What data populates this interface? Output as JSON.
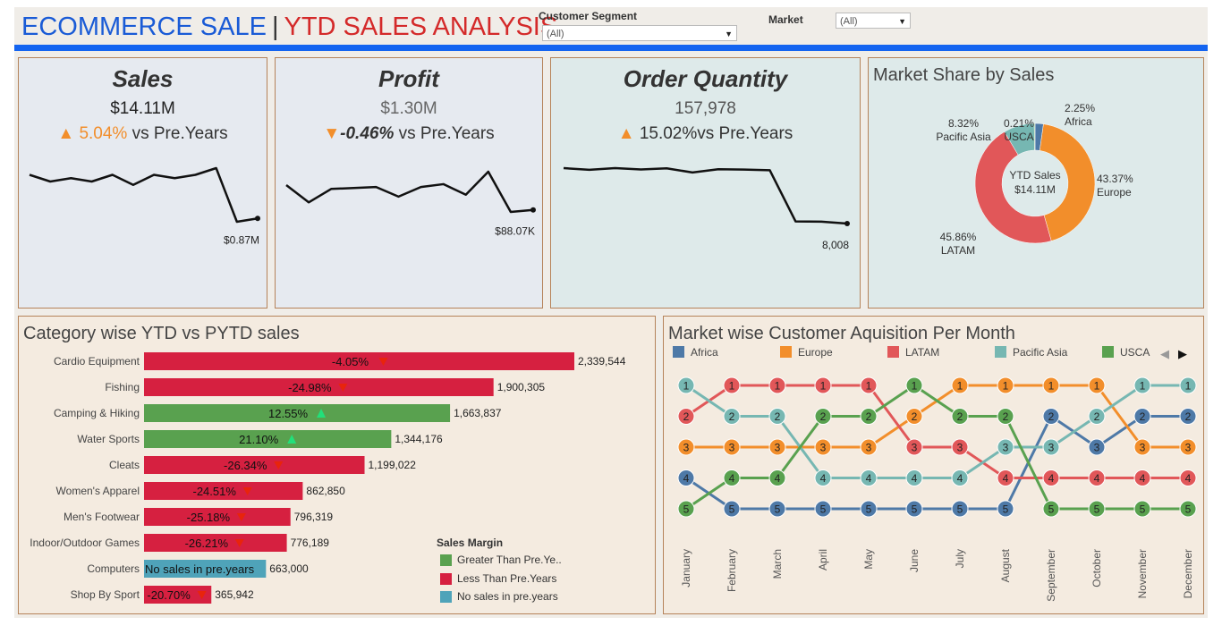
{
  "header": {
    "title_main": "ECOMMERCE SALE",
    "separator": "|",
    "title_sub": "YTD SALES ANALYSIS"
  },
  "filters": {
    "segment_label": "Customer Segment",
    "segment_value": "(All)",
    "market_label": "Market",
    "market_value": "(All)"
  },
  "kpis": {
    "sales": {
      "title": "Sales",
      "value": "$14.11M",
      "change": "5.04%",
      "suffix": " vs Pre.Years",
      "direction": "up",
      "last_label": "$0.87M"
    },
    "profit": {
      "title": "Profit",
      "value": "$1.30M",
      "change": "-0.46%",
      "suffix": " vs Pre.Years",
      "direction": "down",
      "last_label": "$88.07K"
    },
    "orders": {
      "title": "Order Quantity",
      "value": "157,978",
      "change": "15.02%",
      "suffix": "vs Pre.Years",
      "direction": "up",
      "last_label": "8,008"
    }
  },
  "colors": {
    "up": "#f28e2b",
    "down": "#f28e2b",
    "greater": "#59a14f",
    "less": "#d62040",
    "no_sales": "#4fa3b9",
    "africa": "#4e79a7",
    "europe": "#f28e2b",
    "latam": "#e15759",
    "pacific_asia": "#76b7b2",
    "usca": "#59a14f"
  },
  "market_share": {
    "title": "Market Share by Sales",
    "center_line1": "YTD Sales",
    "center_line2": "$14.11M"
  },
  "category_title": "Category wise YTD vs PYTD sales",
  "legend": {
    "title": "Sales Margin",
    "items": [
      "Greater Than Pre.Ye..",
      "Less Than Pre.Years",
      "No sales in pre.years"
    ]
  },
  "rank_title": "Market wise Customer Aquisition Per Month",
  "chart_data": [
    {
      "type": "line",
      "name": "sales_trend",
      "values": [
        0.99,
        0.97,
        0.98,
        0.97,
        0.99,
        0.96,
        0.99,
        0.98,
        0.99,
        1.01,
        0.85,
        0.86
      ],
      "end_label": "$0.87M"
    },
    {
      "type": "line",
      "name": "profit_trend",
      "values": [
        101,
        92,
        99,
        99.5,
        100,
        95,
        100,
        101.5,
        96,
        108,
        87,
        88.07
      ],
      "end_label": "$88.07K"
    },
    {
      "type": "line",
      "name": "order_quantity_trend",
      "values": [
        13100,
        12950,
        13100,
        12980,
        13080,
        12700,
        13000,
        12970,
        12900,
        8200,
        8180,
        8008
      ],
      "end_label": "8,008"
    },
    {
      "type": "pie",
      "name": "market_share",
      "title": "Market Share by Sales",
      "slices": [
        {
          "label": "Africa",
          "pct": "2.25%",
          "value": 2.25,
          "color": "#4e79a7"
        },
        {
          "label": "Europe",
          "pct": "43.37%",
          "value": 43.37,
          "color": "#f28e2b"
        },
        {
          "label": "LATAM",
          "pct": "45.86%",
          "value": 45.86,
          "color": "#e15759"
        },
        {
          "label": "Pacific Asia",
          "pct": "8.32%",
          "value": 8.32,
          "color": "#76b7b2"
        },
        {
          "label": "USCA",
          "pct": "0.21%",
          "value": 0.21,
          "color": "#59a14f"
        }
      ]
    },
    {
      "type": "bar",
      "name": "category_sales",
      "title": "Category wise YTD vs PYTD sales",
      "categories": [
        "Cardio Equipment",
        "Fishing",
        "Camping & Hiking",
        "Water Sports",
        "Cleats",
        "Women's Apparel",
        "Men's Footwear",
        "Indoor/Outdoor Games",
        "Computers",
        "Shop By Sport"
      ],
      "values": [
        2339544,
        1900305,
        1663837,
        1344176,
        1199022,
        862850,
        796319,
        776189,
        663000,
        365942
      ],
      "value_labels": [
        "2,339,544",
        "1,900,305",
        "1,663,837",
        "1,344,176",
        "1,199,022",
        "862,850",
        "796,319",
        "776,189",
        "663,000",
        "365,942"
      ],
      "margins": [
        "-4.05%",
        "-24.98%",
        "12.55%",
        "21.10%",
        "-26.34%",
        "-24.51%",
        "-25.18%",
        "-26.21%",
        "No sales in pre.years",
        "-20.70%"
      ],
      "status": [
        "less",
        "less",
        "greater",
        "greater",
        "less",
        "less",
        "less",
        "less",
        "none",
        "less"
      ],
      "xlim": [
        0,
        2339544
      ]
    },
    {
      "type": "line",
      "name": "customer_acquisition_rank",
      "title": "Market wise Customer Aquisition Per Month",
      "categories": [
        "January",
        "February",
        "March",
        "April",
        "May",
        "June",
        "July",
        "August",
        "September",
        "October",
        "November",
        "December"
      ],
      "ylim": [
        1,
        5
      ],
      "series": [
        {
          "name": "Africa",
          "color": "#4e79a7",
          "values": [
            4,
            5,
            5,
            5,
            5,
            5,
            5,
            5,
            2,
            3,
            2,
            2
          ]
        },
        {
          "name": "Europe",
          "color": "#f28e2b",
          "values": [
            3,
            3,
            3,
            3,
            3,
            2,
            1,
            1,
            1,
            1,
            3,
            3
          ]
        },
        {
          "name": "LATAM",
          "color": "#e15759",
          "values": [
            2,
            1,
            1,
            1,
            1,
            3,
            3,
            4,
            4,
            4,
            4,
            4
          ]
        },
        {
          "name": "Pacific Asia",
          "color": "#76b7b2",
          "values": [
            1,
            2,
            2,
            4,
            4,
            4,
            4,
            3,
            3,
            2,
            1,
            1
          ]
        },
        {
          "name": "USCA",
          "color": "#59a14f",
          "values": [
            5,
            4,
            4,
            2,
            2,
            1,
            2,
            2,
            5,
            5,
            5,
            5
          ]
        }
      ]
    }
  ]
}
